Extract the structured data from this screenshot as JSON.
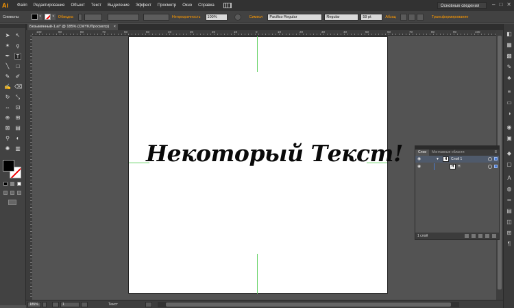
{
  "app": {
    "logo": "Ai"
  },
  "menu": [
    "Файл",
    "Редактирование",
    "Объект",
    "Текст",
    "Выделение",
    "Эффект",
    "Просмотр",
    "Окно",
    "Справка"
  ],
  "workspace": "Основные сведения",
  "window_controls": [
    "–",
    "□",
    "✕"
  ],
  "control_bar": {
    "mode_label": "Символы",
    "stroke_label": "Обводка",
    "opacity_label": "Непрозрачность",
    "opacity_value": "100%",
    "font_label": "Символ",
    "font_value": "Pacifico Regular",
    "style_value": "Regular",
    "size_value": "59 pt",
    "paragraph_label": "Абзац",
    "transform_label": "Трансформирование"
  },
  "document_tab": {
    "title": "Безымянный-1.ai* @ 185% (CMYK/Просмотр)",
    "close": "×"
  },
  "ruler_labels": [
    "100",
    "90",
    "80",
    "70",
    "60",
    "50",
    "40",
    "30",
    "20",
    "10",
    "0",
    "10",
    "20",
    "30",
    "40",
    "50",
    "60",
    "70",
    "80",
    "90",
    "100"
  ],
  "artboard": {
    "text": "Некоторый Текст!"
  },
  "layers_panel": {
    "tabs": [
      "Слои",
      "Монтажные области"
    ],
    "layer_name": "Слой 1",
    "sublayer_name": "Н",
    "thumb_glyph": "H",
    "footer_count": "1 слой",
    "menu_glyph": "≡"
  },
  "status_bar": {
    "zoom": "185%",
    "page": "1",
    "tool": "Текст"
  },
  "colors": {
    "accent": "#ff9a00",
    "guide": "#63d163",
    "selection": "#4a7cd6"
  }
}
